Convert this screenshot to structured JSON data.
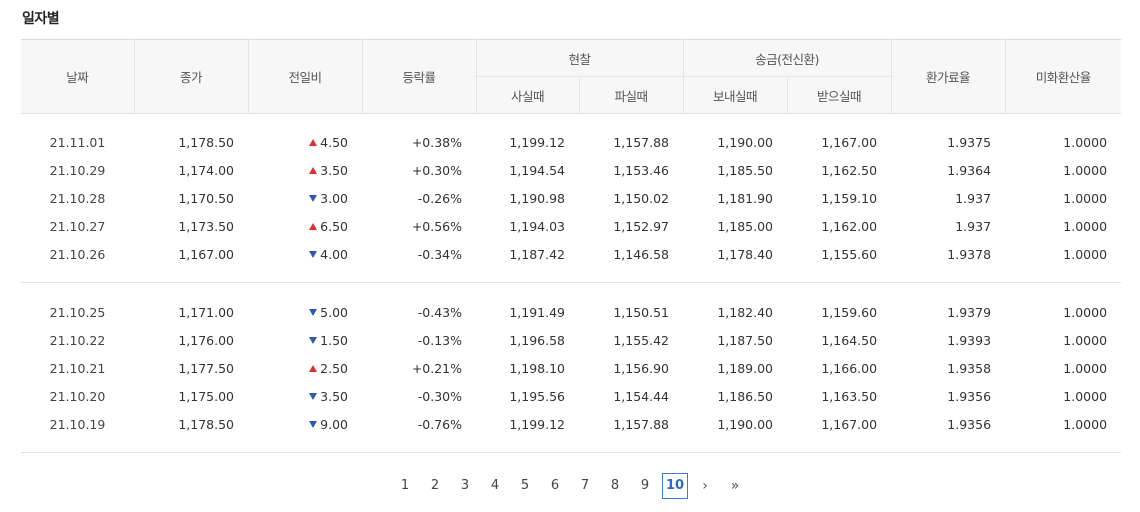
{
  "section": {
    "title": "일자별"
  },
  "table": {
    "headers": {
      "date": "날짜",
      "close": "종가",
      "change": "전일비",
      "change_rate": "등락률",
      "cash_group": "현찰",
      "cash_buy": "사실때",
      "cash_sell": "파실때",
      "transfer_group": "송금(전신환)",
      "transfer_send": "보내실때",
      "transfer_receive": "받으실때",
      "exchange_rate": "환가료율",
      "usd_rate": "미화환산율"
    },
    "rows": [
      {
        "date": "21.11.01",
        "close": "1,178.50",
        "direction": "up",
        "change": "4.50",
        "rate": "+0.38%",
        "cash_buy": "1,199.12",
        "cash_sell": "1,157.88",
        "send": "1,190.00",
        "receive": "1,167.00",
        "exchange_rate": "1.9375",
        "usd_rate": "1.0000"
      },
      {
        "date": "21.10.29",
        "close": "1,174.00",
        "direction": "up",
        "change": "3.50",
        "rate": "+0.30%",
        "cash_buy": "1,194.54",
        "cash_sell": "1,153.46",
        "send": "1,185.50",
        "receive": "1,162.50",
        "exchange_rate": "1.9364",
        "usd_rate": "1.0000"
      },
      {
        "date": "21.10.28",
        "close": "1,170.50",
        "direction": "down",
        "change": "3.00",
        "rate": "-0.26%",
        "cash_buy": "1,190.98",
        "cash_sell": "1,150.02",
        "send": "1,181.90",
        "receive": "1,159.10",
        "exchange_rate": "1.937",
        "usd_rate": "1.0000"
      },
      {
        "date": "21.10.27",
        "close": "1,173.50",
        "direction": "up",
        "change": "6.50",
        "rate": "+0.56%",
        "cash_buy": "1,194.03",
        "cash_sell": "1,152.97",
        "send": "1,185.00",
        "receive": "1,162.00",
        "exchange_rate": "1.937",
        "usd_rate": "1.0000"
      },
      {
        "date": "21.10.26",
        "close": "1,167.00",
        "direction": "down",
        "change": "4.00",
        "rate": "-0.34%",
        "cash_buy": "1,187.42",
        "cash_sell": "1,146.58",
        "send": "1,178.40",
        "receive": "1,155.60",
        "exchange_rate": "1.9378",
        "usd_rate": "1.0000"
      },
      {
        "date": "21.10.25",
        "close": "1,171.00",
        "direction": "down",
        "change": "5.00",
        "rate": "-0.43%",
        "cash_buy": "1,191.49",
        "cash_sell": "1,150.51",
        "send": "1,182.40",
        "receive": "1,159.60",
        "exchange_rate": "1.9379",
        "usd_rate": "1.0000"
      },
      {
        "date": "21.10.22",
        "close": "1,176.00",
        "direction": "down",
        "change": "1.50",
        "rate": "-0.13%",
        "cash_buy": "1,196.58",
        "cash_sell": "1,155.42",
        "send": "1,187.50",
        "receive": "1,164.50",
        "exchange_rate": "1.9393",
        "usd_rate": "1.0000"
      },
      {
        "date": "21.10.21",
        "close": "1,177.50",
        "direction": "up",
        "change": "2.50",
        "rate": "+0.21%",
        "cash_buy": "1,198.10",
        "cash_sell": "1,156.90",
        "send": "1,189.00",
        "receive": "1,166.00",
        "exchange_rate": "1.9358",
        "usd_rate": "1.0000"
      },
      {
        "date": "21.10.20",
        "close": "1,175.00",
        "direction": "down",
        "change": "3.50",
        "rate": "-0.30%",
        "cash_buy": "1,195.56",
        "cash_sell": "1,154.44",
        "send": "1,186.50",
        "receive": "1,163.50",
        "exchange_rate": "1.9356",
        "usd_rate": "1.0000"
      },
      {
        "date": "21.10.19",
        "close": "1,178.50",
        "direction": "down",
        "change": "9.00",
        "rate": "-0.76%",
        "cash_buy": "1,199.12",
        "cash_sell": "1,157.88",
        "send": "1,190.00",
        "receive": "1,167.00",
        "exchange_rate": "1.9356",
        "usd_rate": "1.0000"
      }
    ]
  },
  "pagination": {
    "pages": [
      "1",
      "2",
      "3",
      "4",
      "5",
      "6",
      "7",
      "8",
      "9",
      "10"
    ],
    "current": "10",
    "next_label": "›",
    "last_label": "»"
  },
  "colors": {
    "up": "#dd2f2f",
    "down": "#2e5aac",
    "current_page_border": "#3a7bd5"
  },
  "icons": {
    "up": "triangle-up-icon",
    "down": "triangle-down-icon",
    "next": "chevron-right-icon",
    "last": "double-chevron-right-icon"
  }
}
